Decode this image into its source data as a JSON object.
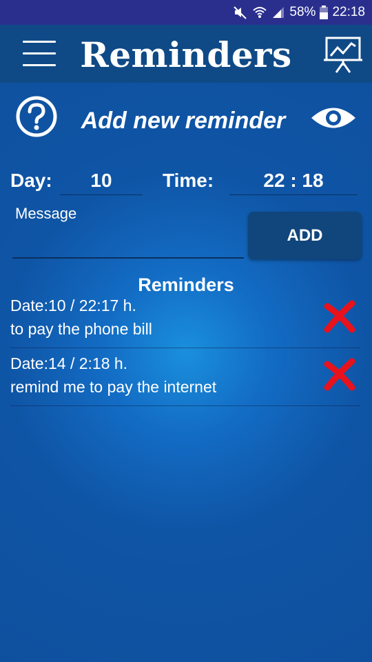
{
  "status_bar": {
    "battery_percent": "58%",
    "time": "22:18",
    "icons": [
      "mute-icon",
      "wifi-icon",
      "signal-icon",
      "battery-icon"
    ]
  },
  "app_bar": {
    "title": "Reminders",
    "menu_icon": "hamburger-menu-icon",
    "stats_icon": "presentation-chart-icon"
  },
  "form": {
    "help_icon": "help-circle-icon",
    "heading": "Add new reminder",
    "eye_icon": "eye-icon",
    "day_label": "Day:",
    "day_value": "10",
    "time_label": "Time:",
    "time_value": "22 : 18",
    "message_label": "Message",
    "message_value": "",
    "add_label": "ADD"
  },
  "list": {
    "title": "Reminders",
    "items": [
      {
        "date": "Date:10 / 22:17 h.",
        "message": "to pay the phone bill"
      },
      {
        "date": "Date:14 / 2:18 h.",
        "message": "remind me to pay the internet"
      }
    ],
    "delete_icon": "red-x-delete-icon"
  },
  "colors": {
    "status_bar": "#2a2f8e",
    "app_bar": "#0f4a86",
    "background": "#0f55a6",
    "delete_red": "#e8121d"
  }
}
